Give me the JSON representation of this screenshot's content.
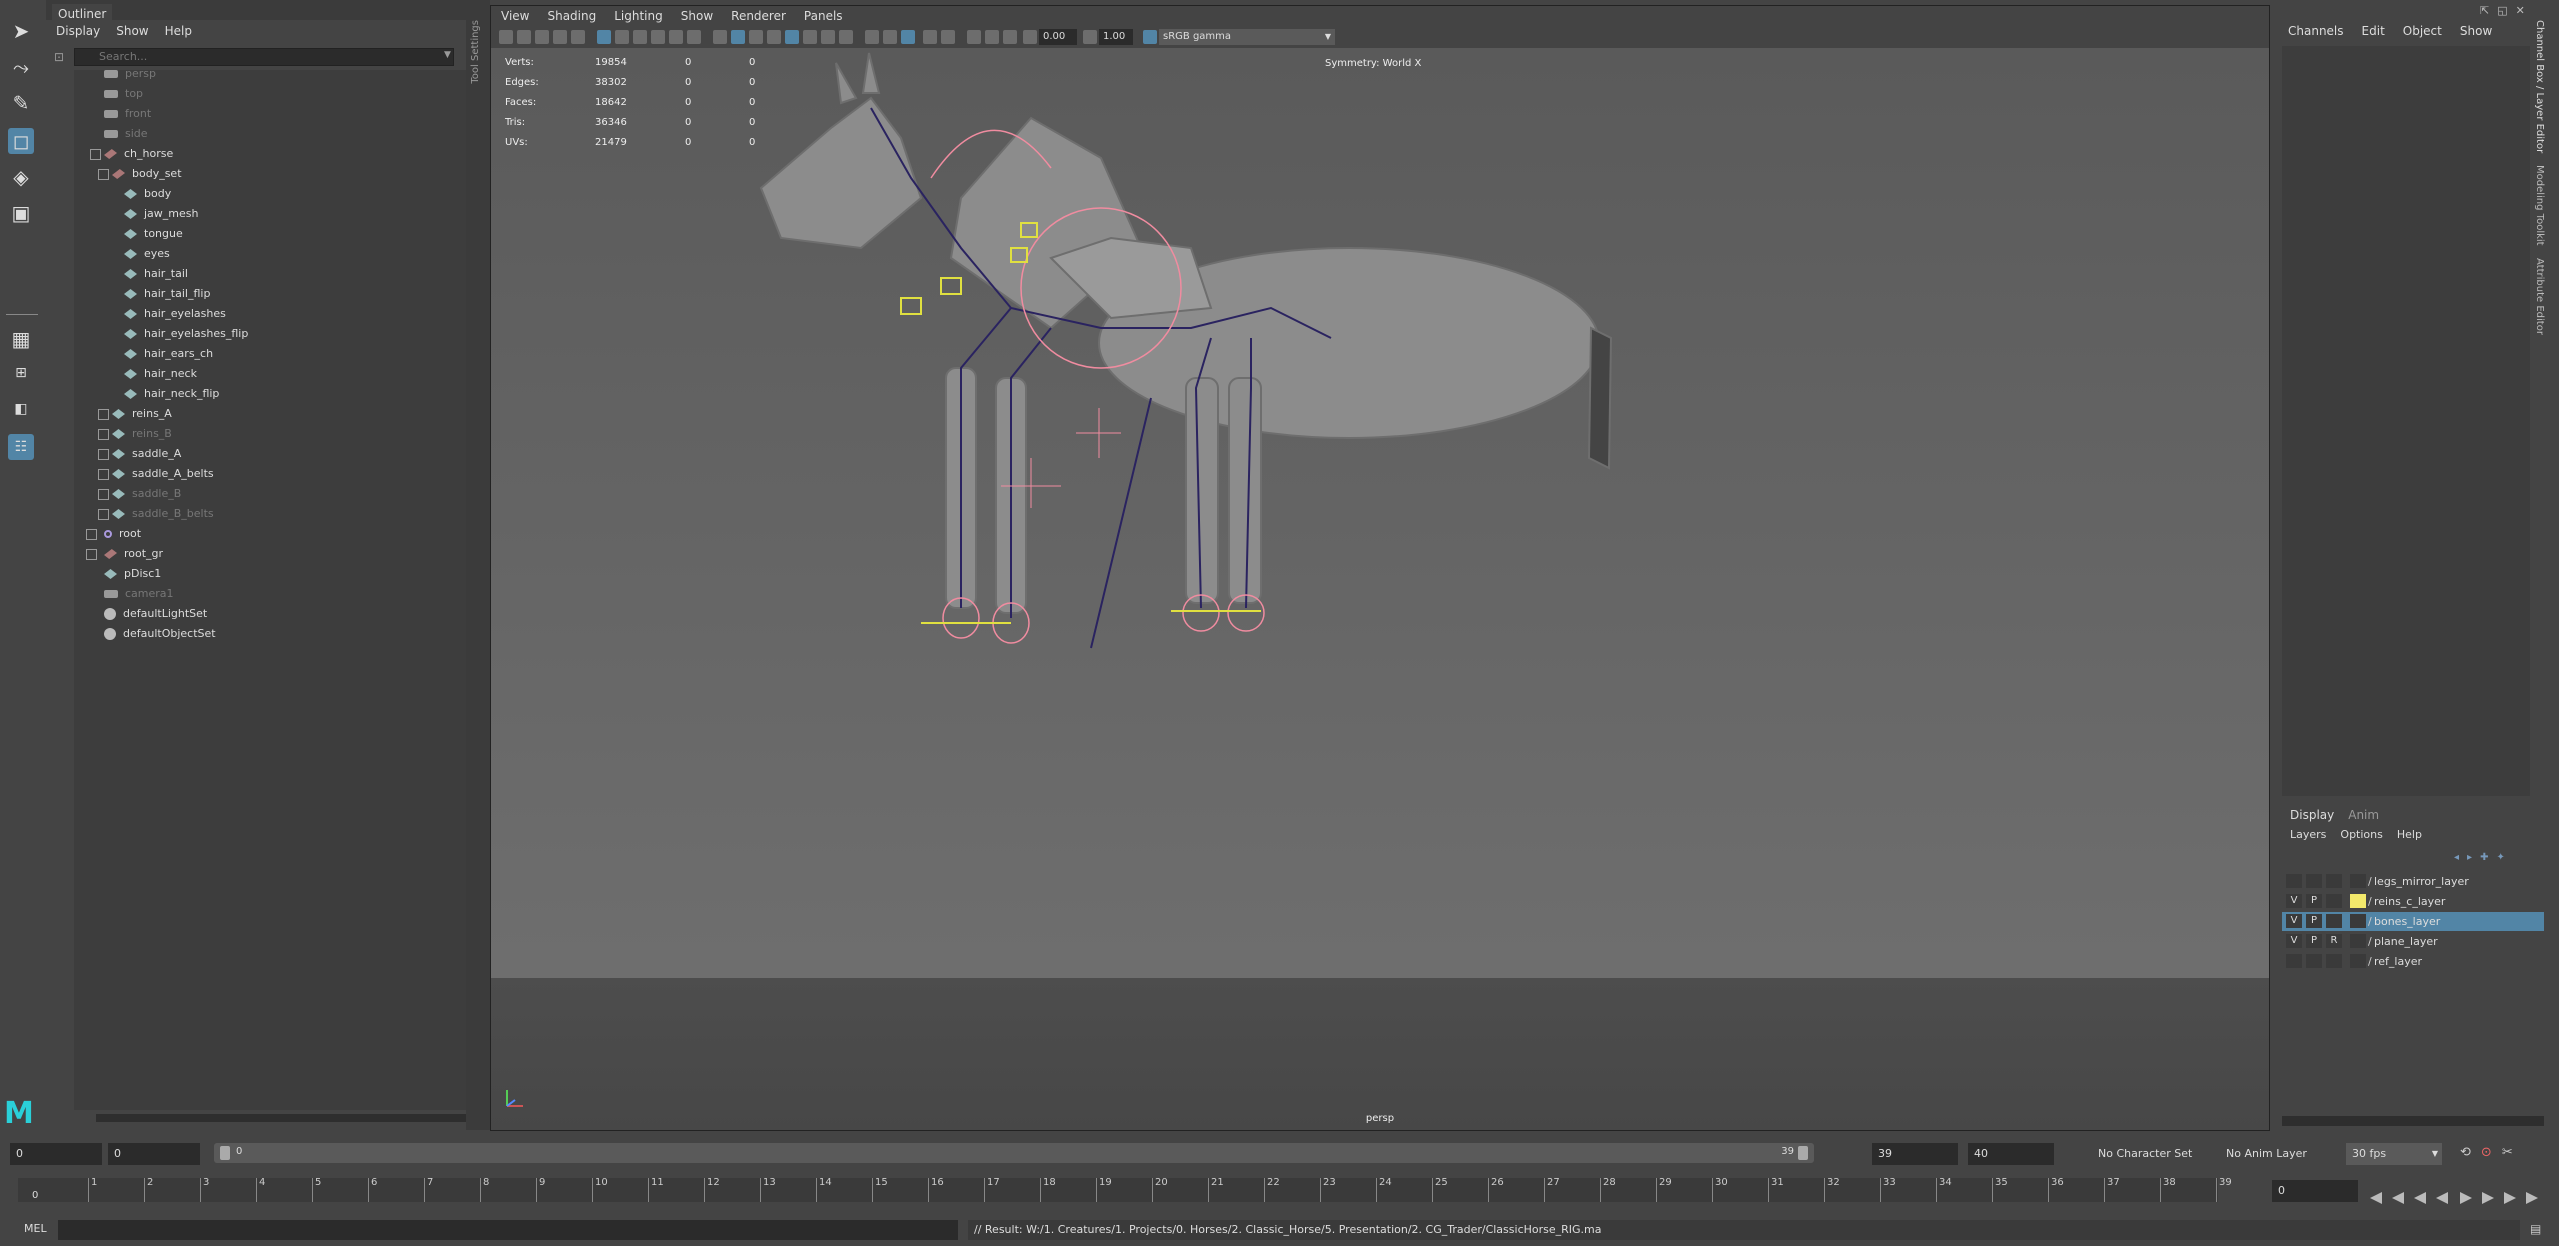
{
  "outliner": {
    "tab_title": "Outliner",
    "menu": [
      "Display",
      "Show",
      "Help"
    ],
    "search_placeholder": "Search...",
    "items": [
      {
        "label": "persp",
        "icon": "camera-icon",
        "dim": true
      },
      {
        "label": "top",
        "icon": "camera-icon",
        "dim": true
      },
      {
        "label": "front",
        "icon": "camera-icon",
        "dim": true
      },
      {
        "label": "side",
        "icon": "camera-icon",
        "dim": true
      },
      {
        "label": "ch_horse",
        "icon": "group-icon",
        "dim": false
      },
      {
        "label": "body_set",
        "icon": "group-icon",
        "dim": false
      },
      {
        "label": "body",
        "icon": "mesh-icon",
        "dim": false
      },
      {
        "label": "jaw_mesh",
        "icon": "mesh-icon",
        "dim": false
      },
      {
        "label": "tongue",
        "icon": "mesh-icon",
        "dim": false
      },
      {
        "label": "eyes",
        "icon": "mesh-icon",
        "dim": false
      },
      {
        "label": "hair_tail",
        "icon": "mesh-icon",
        "dim": false
      },
      {
        "label": "hair_tail_flip",
        "icon": "mesh-icon",
        "dim": false
      },
      {
        "label": "hair_eyelashes",
        "icon": "mesh-icon",
        "dim": false
      },
      {
        "label": "hair_eyelashes_flip",
        "icon": "mesh-icon",
        "dim": false
      },
      {
        "label": "hair_ears_ch",
        "icon": "mesh-icon",
        "dim": false
      },
      {
        "label": "hair_neck",
        "icon": "mesh-icon",
        "dim": false
      },
      {
        "label": "hair_neck_flip",
        "icon": "mesh-icon",
        "dim": false
      },
      {
        "label": "reins_A",
        "icon": "mesh-icon",
        "dim": false
      },
      {
        "label": "reins_B",
        "icon": "mesh-icon",
        "dim": true
      },
      {
        "label": "saddle_A",
        "icon": "mesh-icon",
        "dim": false
      },
      {
        "label": "saddle_A_belts",
        "icon": "mesh-icon",
        "dim": false
      },
      {
        "label": "saddle_B",
        "icon": "mesh-icon",
        "dim": true
      },
      {
        "label": "saddle_B_belts",
        "icon": "mesh-icon",
        "dim": true
      },
      {
        "label": "root",
        "icon": "joint-icon",
        "dim": false
      },
      {
        "label": "root_gr",
        "icon": "group-icon",
        "dim": false
      },
      {
        "label": "pDisc1",
        "icon": "mesh-icon",
        "dim": false
      },
      {
        "label": "camera1",
        "icon": "camera-icon",
        "dim": true
      },
      {
        "label": "defaultLightSet",
        "icon": "set-icon",
        "dim": false
      },
      {
        "label": "defaultObjectSet",
        "icon": "set-icon",
        "dim": false
      }
    ]
  },
  "toolstrip": {
    "label": "Tool Settings"
  },
  "viewport": {
    "menu": [
      "View",
      "Shading",
      "Lighting",
      "Show",
      "Renderer",
      "Panels"
    ],
    "exposure": "0.00",
    "gamma": "1.00",
    "colorspace": "sRGB gamma",
    "hud": [
      {
        "label": "Verts:",
        "value": "19854",
        "a": "0",
        "b": "0"
      },
      {
        "label": "Edges:",
        "value": "38302",
        "a": "0",
        "b": "0"
      },
      {
        "label": "Faces:",
        "value": "18642",
        "a": "0",
        "b": "0"
      },
      {
        "label": "Tris:",
        "value": "36346",
        "a": "0",
        "b": "0"
      },
      {
        "label": "UVs:",
        "value": "21479",
        "a": "0",
        "b": "0"
      }
    ],
    "symmetry": "Symmetry: World X",
    "camera": "persp"
  },
  "channelbox": {
    "menu": [
      "Channels",
      "Edit",
      "Object",
      "Show"
    ],
    "side_tabs": [
      "Channel Box / Layer Editor",
      "Modeling Toolkit",
      "Attribute Editor"
    ]
  },
  "layers": {
    "tabs": [
      "Display",
      "Anim"
    ],
    "menu": [
      "Layers",
      "Options",
      "Help"
    ],
    "rows": [
      {
        "v": "",
        "p": "",
        "r": "",
        "name": "legs_mirror_layer",
        "color": "",
        "selected": false
      },
      {
        "v": "V",
        "p": "P",
        "r": "",
        "name": "reins_c_layer",
        "color": "#f3e96b",
        "selected": false
      },
      {
        "v": "V",
        "p": "P",
        "r": "",
        "name": "bones_layer",
        "color": "",
        "selected": true
      },
      {
        "v": "V",
        "p": "P",
        "r": "R",
        "name": "plane_layer",
        "color": "",
        "selected": false
      },
      {
        "v": "",
        "p": "",
        "r": "",
        "name": "ref_layer",
        "color": "",
        "selected": false
      }
    ]
  },
  "timeline": {
    "start": "0",
    "range_start": "0",
    "range_field": "0",
    "range_end_label": "39",
    "end_field": "39",
    "anim_end": "40",
    "character_set": "No Character Set",
    "anim_layer": "No Anim Layer",
    "fps": "30 fps",
    "current_frame": "0",
    "playhead_label": "0",
    "ticks": [
      "1",
      "2",
      "3",
      "4",
      "5",
      "6",
      "7",
      "8",
      "9",
      "10",
      "11",
      "12",
      "13",
      "14",
      "15",
      "16",
      "17",
      "18",
      "19",
      "20",
      "21",
      "22",
      "23",
      "24",
      "25",
      "26",
      "27",
      "28",
      "29",
      "30",
      "31",
      "32",
      "33",
      "34",
      "35",
      "36",
      "37",
      "38",
      "39"
    ]
  },
  "commandline": {
    "lang": "MEL",
    "result": "// Result: W:/1. Creatures/1. Projects/0. Horses/2. Classic_Horse/5. Presentation/2. CG_Trader/ClassicHorse_RIG.ma"
  },
  "colors": {
    "accent": "#5285a6",
    "panel": "#444444",
    "viewport_bg": "#5a5a5a"
  }
}
